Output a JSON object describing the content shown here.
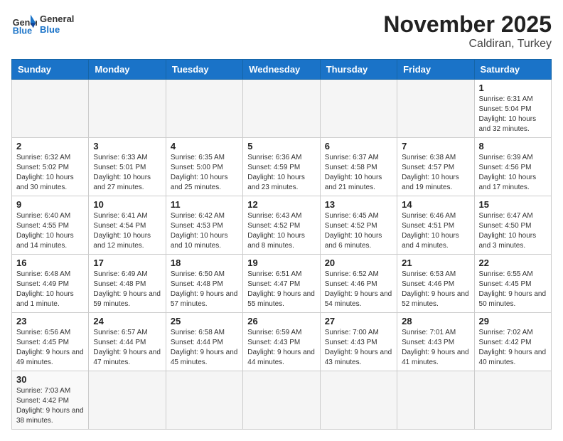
{
  "logo": {
    "text_general": "General",
    "text_blue": "Blue"
  },
  "header": {
    "month": "November 2025",
    "location": "Caldiran, Turkey"
  },
  "days_of_week": [
    "Sunday",
    "Monday",
    "Tuesday",
    "Wednesday",
    "Thursday",
    "Friday",
    "Saturday"
  ],
  "weeks": [
    [
      {
        "day": "",
        "info": ""
      },
      {
        "day": "",
        "info": ""
      },
      {
        "day": "",
        "info": ""
      },
      {
        "day": "",
        "info": ""
      },
      {
        "day": "",
        "info": ""
      },
      {
        "day": "",
        "info": ""
      },
      {
        "day": "1",
        "info": "Sunrise: 6:31 AM\nSunset: 5:04 PM\nDaylight: 10 hours and 32 minutes."
      }
    ],
    [
      {
        "day": "2",
        "info": "Sunrise: 6:32 AM\nSunset: 5:02 PM\nDaylight: 10 hours and 30 minutes."
      },
      {
        "day": "3",
        "info": "Sunrise: 6:33 AM\nSunset: 5:01 PM\nDaylight: 10 hours and 27 minutes."
      },
      {
        "day": "4",
        "info": "Sunrise: 6:35 AM\nSunset: 5:00 PM\nDaylight: 10 hours and 25 minutes."
      },
      {
        "day": "5",
        "info": "Sunrise: 6:36 AM\nSunset: 4:59 PM\nDaylight: 10 hours and 23 minutes."
      },
      {
        "day": "6",
        "info": "Sunrise: 6:37 AM\nSunset: 4:58 PM\nDaylight: 10 hours and 21 minutes."
      },
      {
        "day": "7",
        "info": "Sunrise: 6:38 AM\nSunset: 4:57 PM\nDaylight: 10 hours and 19 minutes."
      },
      {
        "day": "8",
        "info": "Sunrise: 6:39 AM\nSunset: 4:56 PM\nDaylight: 10 hours and 17 minutes."
      }
    ],
    [
      {
        "day": "9",
        "info": "Sunrise: 6:40 AM\nSunset: 4:55 PM\nDaylight: 10 hours and 14 minutes."
      },
      {
        "day": "10",
        "info": "Sunrise: 6:41 AM\nSunset: 4:54 PM\nDaylight: 10 hours and 12 minutes."
      },
      {
        "day": "11",
        "info": "Sunrise: 6:42 AM\nSunset: 4:53 PM\nDaylight: 10 hours and 10 minutes."
      },
      {
        "day": "12",
        "info": "Sunrise: 6:43 AM\nSunset: 4:52 PM\nDaylight: 10 hours and 8 minutes."
      },
      {
        "day": "13",
        "info": "Sunrise: 6:45 AM\nSunset: 4:52 PM\nDaylight: 10 hours and 6 minutes."
      },
      {
        "day": "14",
        "info": "Sunrise: 6:46 AM\nSunset: 4:51 PM\nDaylight: 10 hours and 4 minutes."
      },
      {
        "day": "15",
        "info": "Sunrise: 6:47 AM\nSunset: 4:50 PM\nDaylight: 10 hours and 3 minutes."
      }
    ],
    [
      {
        "day": "16",
        "info": "Sunrise: 6:48 AM\nSunset: 4:49 PM\nDaylight: 10 hours and 1 minute."
      },
      {
        "day": "17",
        "info": "Sunrise: 6:49 AM\nSunset: 4:48 PM\nDaylight: 9 hours and 59 minutes."
      },
      {
        "day": "18",
        "info": "Sunrise: 6:50 AM\nSunset: 4:48 PM\nDaylight: 9 hours and 57 minutes."
      },
      {
        "day": "19",
        "info": "Sunrise: 6:51 AM\nSunset: 4:47 PM\nDaylight: 9 hours and 55 minutes."
      },
      {
        "day": "20",
        "info": "Sunrise: 6:52 AM\nSunset: 4:46 PM\nDaylight: 9 hours and 54 minutes."
      },
      {
        "day": "21",
        "info": "Sunrise: 6:53 AM\nSunset: 4:46 PM\nDaylight: 9 hours and 52 minutes."
      },
      {
        "day": "22",
        "info": "Sunrise: 6:55 AM\nSunset: 4:45 PM\nDaylight: 9 hours and 50 minutes."
      }
    ],
    [
      {
        "day": "23",
        "info": "Sunrise: 6:56 AM\nSunset: 4:45 PM\nDaylight: 9 hours and 49 minutes."
      },
      {
        "day": "24",
        "info": "Sunrise: 6:57 AM\nSunset: 4:44 PM\nDaylight: 9 hours and 47 minutes."
      },
      {
        "day": "25",
        "info": "Sunrise: 6:58 AM\nSunset: 4:44 PM\nDaylight: 9 hours and 45 minutes."
      },
      {
        "day": "26",
        "info": "Sunrise: 6:59 AM\nSunset: 4:43 PM\nDaylight: 9 hours and 44 minutes."
      },
      {
        "day": "27",
        "info": "Sunrise: 7:00 AM\nSunset: 4:43 PM\nDaylight: 9 hours and 43 minutes."
      },
      {
        "day": "28",
        "info": "Sunrise: 7:01 AM\nSunset: 4:43 PM\nDaylight: 9 hours and 41 minutes."
      },
      {
        "day": "29",
        "info": "Sunrise: 7:02 AM\nSunset: 4:42 PM\nDaylight: 9 hours and 40 minutes."
      }
    ],
    [
      {
        "day": "30",
        "info": "Sunrise: 7:03 AM\nSunset: 4:42 PM\nDaylight: 9 hours and 38 minutes."
      },
      {
        "day": "",
        "info": ""
      },
      {
        "day": "",
        "info": ""
      },
      {
        "day": "",
        "info": ""
      },
      {
        "day": "",
        "info": ""
      },
      {
        "day": "",
        "info": ""
      },
      {
        "day": "",
        "info": ""
      }
    ]
  ]
}
